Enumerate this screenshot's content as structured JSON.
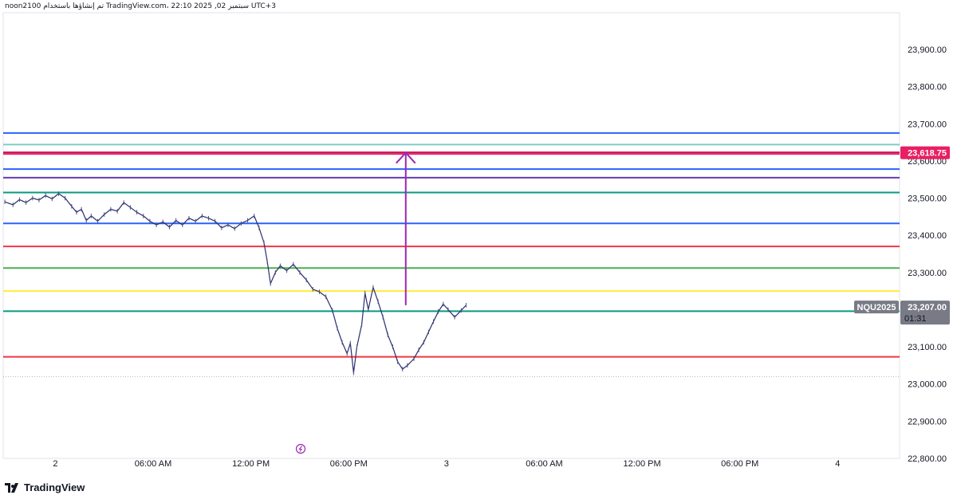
{
  "header": {
    "caption": "noon2100 تم إنشاؤها باستخدام TradingView.com، 22:10 2025 ,02 سبتمبر UTC+3"
  },
  "footer": {
    "brand": "TradingView"
  },
  "chart_data": {
    "type": "line",
    "symbol": "NQU2025",
    "last_price": "23,207.00",
    "countdown": "01:31",
    "target_label": "23,618.75",
    "ylim": [
      22800,
      23960
    ],
    "y_ticks": [
      23900,
      23800,
      23700,
      23600,
      23500,
      23400,
      23300,
      23200,
      23100,
      23000,
      22900,
      22800
    ],
    "y_tick_labels": [
      "23,900.00",
      "23,800.00",
      "23,700.00",
      "23,600.00",
      "23,500.00",
      "23,400.00",
      "23,300.00",
      "23,200.00",
      "23,100.00",
      "23,000.00",
      "22,900.00",
      "22,800.00"
    ],
    "x_ticks": [
      {
        "label": "2",
        "t": 0
      },
      {
        "label": "06:00 AM",
        "t": 6
      },
      {
        "label": "12:00 PM",
        "t": 12
      },
      {
        "label": "06:00 PM",
        "t": 18
      },
      {
        "label": "3",
        "t": 24
      },
      {
        "label": "06:00 AM",
        "t": 30
      },
      {
        "label": "12:00 PM",
        "t": 36
      },
      {
        "label": "06:00 PM",
        "t": 42
      },
      {
        "label": "4",
        "t": 48
      }
    ],
    "x_range_hours": [
      -3.2,
      51.8
    ],
    "horizontal_levels": [
      {
        "price": 23675,
        "color": "#2962ff"
      },
      {
        "price": 23644,
        "color": "#80cbc4"
      },
      {
        "price": 23623,
        "color": "#c2185b"
      },
      {
        "price": 23618.75,
        "color": "#e91e63"
      },
      {
        "price": 23578,
        "color": "#2962ff"
      },
      {
        "price": 23555,
        "color": "#673ab7"
      },
      {
        "price": 23515,
        "color": "#089981"
      },
      {
        "price": 23432,
        "color": "#2962ff"
      },
      {
        "price": 23370,
        "color": "#f23645"
      },
      {
        "price": 23312,
        "color": "#4caf50"
      },
      {
        "price": 23250,
        "color": "#ffeb3b"
      },
      {
        "price": 23196,
        "color": "#089981"
      },
      {
        "price": 23073,
        "color": "#f23645"
      }
    ],
    "dotted_level": 23020,
    "arrow": {
      "from_price": 23212,
      "to_price": 23622,
      "t": 21.5,
      "color": "#9c27b0"
    },
    "series": [
      {
        "values": [
          [
            -3.1,
            23490
          ],
          [
            -2.6,
            23482
          ],
          [
            -2.2,
            23496
          ],
          [
            -1.8,
            23488
          ],
          [
            -1.4,
            23500
          ],
          [
            -1.0,
            23495
          ],
          [
            -0.6,
            23507
          ],
          [
            -0.2,
            23498
          ],
          [
            0.2,
            23512
          ],
          [
            0.6,
            23500
          ],
          [
            1.0,
            23478
          ],
          [
            1.3,
            23462
          ],
          [
            1.6,
            23470
          ],
          [
            1.9,
            23440
          ],
          [
            2.2,
            23452
          ],
          [
            2.6,
            23438
          ],
          [
            3.0,
            23456
          ],
          [
            3.4,
            23470
          ],
          [
            3.8,
            23465
          ],
          [
            4.2,
            23488
          ],
          [
            4.6,
            23475
          ],
          [
            5.0,
            23462
          ],
          [
            5.4,
            23452
          ],
          [
            5.8,
            23438
          ],
          [
            6.2,
            23428
          ],
          [
            6.6,
            23436
          ],
          [
            7.0,
            23422
          ],
          [
            7.4,
            23440
          ],
          [
            7.8,
            23428
          ],
          [
            8.2,
            23446
          ],
          [
            8.6,
            23438
          ],
          [
            9.0,
            23452
          ],
          [
            9.4,
            23446
          ],
          [
            9.8,
            23438
          ],
          [
            10.2,
            23420
          ],
          [
            10.6,
            23428
          ],
          [
            11.0,
            23418
          ],
          [
            11.4,
            23432
          ],
          [
            11.8,
            23440
          ],
          [
            12.2,
            23452
          ],
          [
            12.5,
            23420
          ],
          [
            12.8,
            23380
          ],
          [
            13.0,
            23330
          ],
          [
            13.2,
            23270
          ],
          [
            13.5,
            23300
          ],
          [
            13.8,
            23318
          ],
          [
            14.2,
            23305
          ],
          [
            14.6,
            23322
          ],
          [
            15.0,
            23300
          ],
          [
            15.4,
            23280
          ],
          [
            15.8,
            23255
          ],
          [
            16.2,
            23248
          ],
          [
            16.6,
            23235
          ],
          [
            17.0,
            23198
          ],
          [
            17.3,
            23150
          ],
          [
            17.6,
            23112
          ],
          [
            17.9,
            23082
          ],
          [
            18.1,
            23110
          ],
          [
            18.3,
            23030
          ],
          [
            18.5,
            23100
          ],
          [
            18.8,
            23160
          ],
          [
            19.0,
            23245
          ],
          [
            19.2,
            23200
          ],
          [
            19.5,
            23260
          ],
          [
            19.8,
            23222
          ],
          [
            20.1,
            23180
          ],
          [
            20.4,
            23132
          ],
          [
            20.7,
            23100
          ],
          [
            21.0,
            23060
          ],
          [
            21.3,
            23040
          ],
          [
            21.6,
            23050
          ],
          [
            22.0,
            23068
          ],
          [
            22.3,
            23092
          ],
          [
            22.6,
            23112
          ],
          [
            22.9,
            23140
          ],
          [
            23.2,
            23168
          ],
          [
            23.5,
            23195
          ],
          [
            23.8,
            23215
          ],
          [
            24.1,
            23200
          ],
          [
            24.5,
            23180
          ],
          [
            24.9,
            23198
          ],
          [
            25.2,
            23212
          ]
        ]
      }
    ]
  }
}
